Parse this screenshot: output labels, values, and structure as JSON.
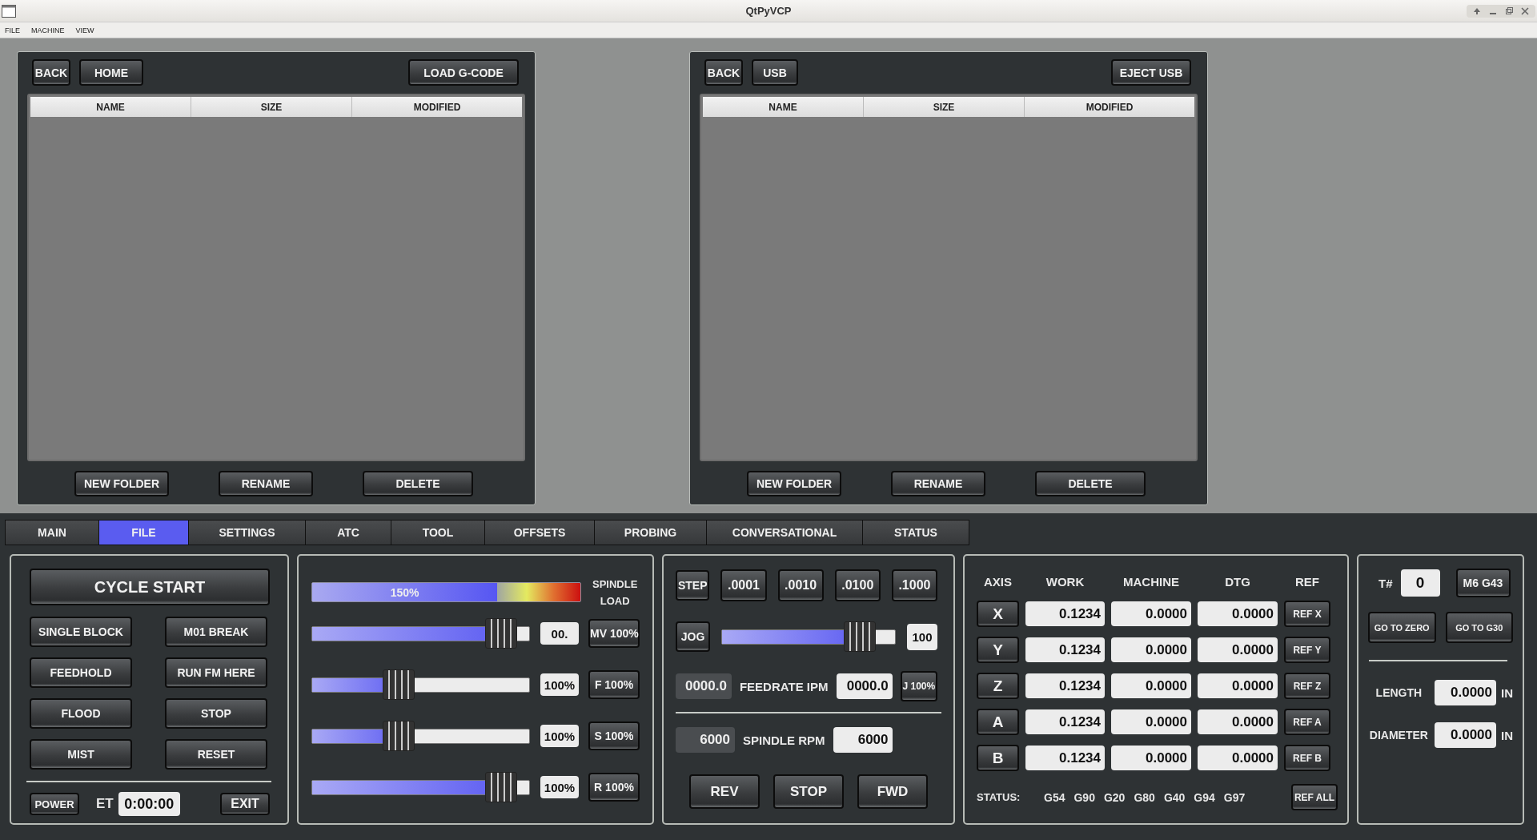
{
  "window": {
    "title": "QtPyVCP"
  },
  "menu": [
    "FILE",
    "MACHINE",
    "VIEW"
  ],
  "file_panels": [
    {
      "nav_buttons": [
        "BACK",
        "HOME"
      ],
      "action_button": "LOAD G-CODE",
      "columns": [
        "NAME",
        "SIZE",
        "MODIFIED"
      ],
      "footer_buttons": [
        "NEW FOLDER",
        "RENAME",
        "DELETE"
      ]
    },
    {
      "nav_buttons": [
        "BACK",
        "USB"
      ],
      "action_button": "EJECT USB",
      "columns": [
        "NAME",
        "SIZE",
        "MODIFIED"
      ],
      "footer_buttons": [
        "NEW FOLDER",
        "RENAME",
        "DELETE"
      ]
    }
  ],
  "tabs": [
    {
      "label": "MAIN",
      "selected": false
    },
    {
      "label": "FILE",
      "selected": true
    },
    {
      "label": "SETTINGS",
      "selected": false
    },
    {
      "label": "ATC",
      "selected": false
    },
    {
      "label": "TOOL",
      "selected": false
    },
    {
      "label": "OFFSETS",
      "selected": false
    },
    {
      "label": "PROBING",
      "selected": false
    },
    {
      "label": "CONVERSATIONAL",
      "selected": false
    },
    {
      "label": "STATUS",
      "selected": false
    }
  ],
  "program": {
    "cycle_start": "CYCLE START",
    "buttons": [
      "SINGLE BLOCK",
      "M01 BREAK",
      "FEEDHOLD",
      "RUN FM HERE",
      "FLOOD",
      "STOP",
      "MIST",
      "RESET"
    ],
    "power": "POWER",
    "et_label": "ET",
    "et_value": "0:00:00",
    "exit": "EXIT"
  },
  "overrides": {
    "spindle_load": {
      "value": "150%",
      "level": 0.69,
      "label": [
        "SPINDLE",
        "LOAD"
      ]
    },
    "sliders": [
      {
        "level": 0.92,
        "value": "00.",
        "button": "MV 100%"
      },
      {
        "level": 0.45,
        "value": "100%",
        "button": "F 100%"
      },
      {
        "level": 0.45,
        "value": "100%",
        "button": "S 100%"
      },
      {
        "level": 0.92,
        "value": "100%",
        "button": "R 100%"
      }
    ]
  },
  "jog": {
    "step": "STEP",
    "increments": [
      ".0001",
      ".0010",
      ".0100",
      ".1000"
    ],
    "jog": "JOG",
    "jog_slider": {
      "level": 0.86,
      "value": "100"
    },
    "feedrate": {
      "actual": "0000.0",
      "label": "FEEDRATE IPM",
      "value": "0000.0",
      "button": "J 100%"
    },
    "spindle": {
      "actual": "6000",
      "label": "SPINDLE RPM",
      "value": "6000"
    },
    "spindle_buttons": [
      "REV",
      "STOP",
      "FWD"
    ]
  },
  "dro": {
    "columns": [
      "AXIS",
      "WORK",
      "MACHINE",
      "DTG",
      "REF"
    ],
    "rows": [
      {
        "axis": "X",
        "work": "0.1234",
        "machine": "0.0000",
        "dtg": "0.0000",
        "ref": "REF X"
      },
      {
        "axis": "Y",
        "work": "0.1234",
        "machine": "0.0000",
        "dtg": "0.0000",
        "ref": "REF Y"
      },
      {
        "axis": "Z",
        "work": "0.1234",
        "machine": "0.0000",
        "dtg": "0.0000",
        "ref": "REF Z"
      },
      {
        "axis": "A",
        "work": "0.1234",
        "machine": "0.0000",
        "dtg": "0.0000",
        "ref": "REF A"
      },
      {
        "axis": "B",
        "work": "0.1234",
        "machine": "0.0000",
        "dtg": "0.0000",
        "ref": "REF B"
      }
    ],
    "status_label": "STATUS:",
    "status_codes": [
      "G54",
      "G90",
      "G20",
      "G80",
      "G40",
      "G94",
      "G97"
    ],
    "ref_all": "REF ALL"
  },
  "tool": {
    "label": "T#",
    "number": "0",
    "m6_button": "M6 G43",
    "buttons": [
      "GO TO ZERO",
      "GO TO G30"
    ],
    "fields": [
      {
        "label": "LENGTH",
        "value": "0.0000",
        "unit": "IN"
      },
      {
        "label": "DIAMETER",
        "value": "0.0000",
        "unit": "IN"
      }
    ]
  }
}
